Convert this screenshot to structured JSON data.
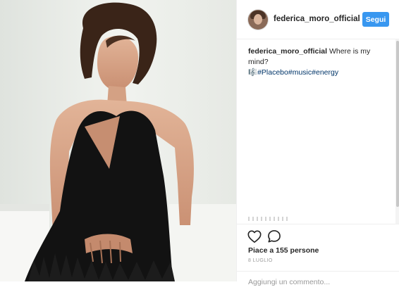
{
  "post": {
    "username": "federica_moro_official",
    "follow_label": "Segui",
    "caption": {
      "username": "federica_moro_official",
      "text": " Where is my mind?",
      "emoji": "🎼",
      "hashtags": [
        "#Placebo",
        "#music",
        "#energy"
      ]
    },
    "likes_text": "Piace a 155 persone",
    "date_text": "8 LUGLIO",
    "comment_placeholder": "Aggiungi un commento..."
  },
  "colors": {
    "follow_button": "#3897f0",
    "hashtag": "#003569",
    "text": "#262626",
    "muted": "#999999"
  },
  "icons": [
    "heart-icon",
    "comment-icon"
  ]
}
